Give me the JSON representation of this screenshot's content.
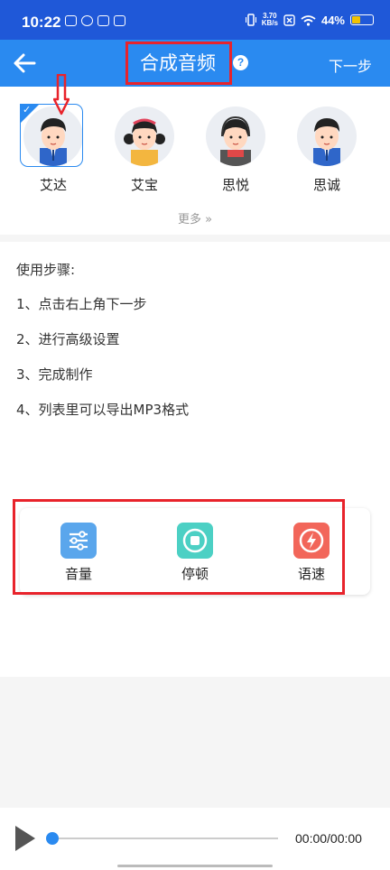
{
  "status_bar": {
    "time": "10:22",
    "net_speed_value": "3.70",
    "net_speed_unit": "KB/s",
    "battery": "44%",
    "battery_level": 0.44
  },
  "header": {
    "title": "合成音频",
    "help_glyph": "?",
    "next_label": "下一步"
  },
  "voices": {
    "items": [
      {
        "name": "艾达",
        "selected": true
      },
      {
        "name": "艾宝",
        "selected": false
      },
      {
        "name": "思悦",
        "selected": false
      },
      {
        "name": "思诚",
        "selected": false
      }
    ],
    "more_label": "更多 »"
  },
  "steps": {
    "title": "使用步骤:",
    "items": [
      "1、点击右上角下一步",
      "2、进行高级设置",
      "3、完成制作",
      "4、列表里可以导出MP3格式"
    ]
  },
  "controls": {
    "items": [
      {
        "label": "音量",
        "icon": "sliders-icon",
        "color": "#5aa6ec"
      },
      {
        "label": "停顿",
        "icon": "stop-circle-icon",
        "color": "#4cd0c4"
      },
      {
        "label": "语速",
        "icon": "lightning-icon",
        "color": "#f2665a"
      }
    ]
  },
  "player": {
    "time": "00:00/00:00",
    "progress": 0
  },
  "colors": {
    "status_bar": "#1f58d8",
    "header": "#2a8af0",
    "highlight": "#e8232b"
  }
}
